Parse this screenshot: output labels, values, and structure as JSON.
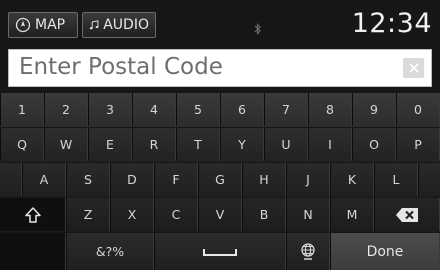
{
  "status_bar": {
    "map_label": "MAP",
    "audio_label": "AUDIO",
    "clock": "12:34"
  },
  "entry": {
    "placeholder": "Enter Postal Code"
  },
  "keyboard": {
    "number_row": [
      "1",
      "2",
      "3",
      "4",
      "5",
      "6",
      "7",
      "8",
      "9",
      "0"
    ],
    "row1": [
      "Q",
      "W",
      "E",
      "R",
      "T",
      "Y",
      "U",
      "I",
      "O",
      "P"
    ],
    "row2": [
      "A",
      "S",
      "D",
      "F",
      "G",
      "H",
      "J",
      "K",
      "L"
    ],
    "row3": [
      "Z",
      "X",
      "C",
      "V",
      "B",
      "N",
      "M"
    ],
    "symbols_label": "&?%",
    "done_label": "Done"
  },
  "icons": {
    "map": "compass-icon",
    "audio": "music-note-icon",
    "status": "bluetooth-icon",
    "clear": "close-icon",
    "shift": "shift-arrow-icon",
    "backspace": "backspace-icon",
    "space": "space-bar-icon",
    "language": "globe-icon"
  }
}
